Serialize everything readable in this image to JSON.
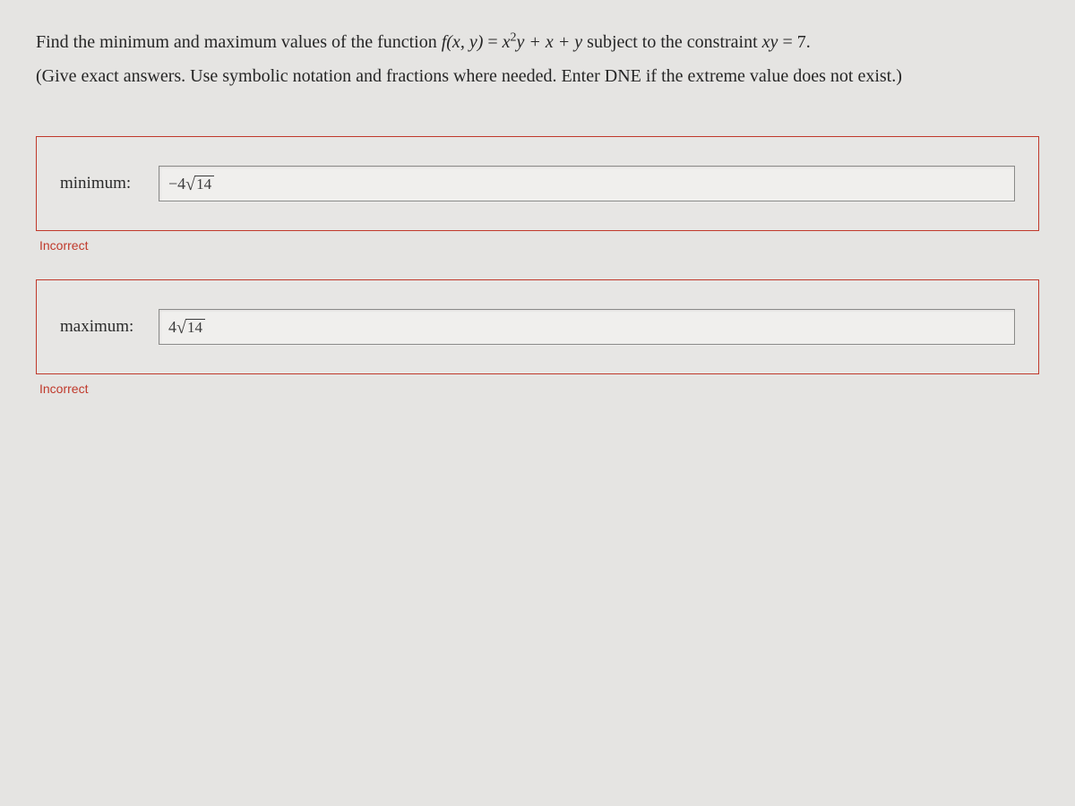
{
  "problem": {
    "line1_pre": "Find the minimum and maximum values of the function ",
    "fxy_lhs": "f(x, y)",
    "eq": " = ",
    "x_sq": "x",
    "sq_exp": "2",
    "after_sq": "y + x + y",
    "subject": " subject to the constraint ",
    "constraint_lhs": "xy",
    "constraint_rhs": " = 7.",
    "line2": "(Give exact answers. Use symbolic notation and fractions where needed. Enter DNE if the extreme value does not exist.)"
  },
  "answers": {
    "minimum": {
      "label": "minimum:",
      "coef": "−4",
      "radicand": "14",
      "feedback": "Incorrect"
    },
    "maximum": {
      "label": "maximum:",
      "coef": "4",
      "radicand": "14",
      "feedback": "Incorrect"
    }
  }
}
